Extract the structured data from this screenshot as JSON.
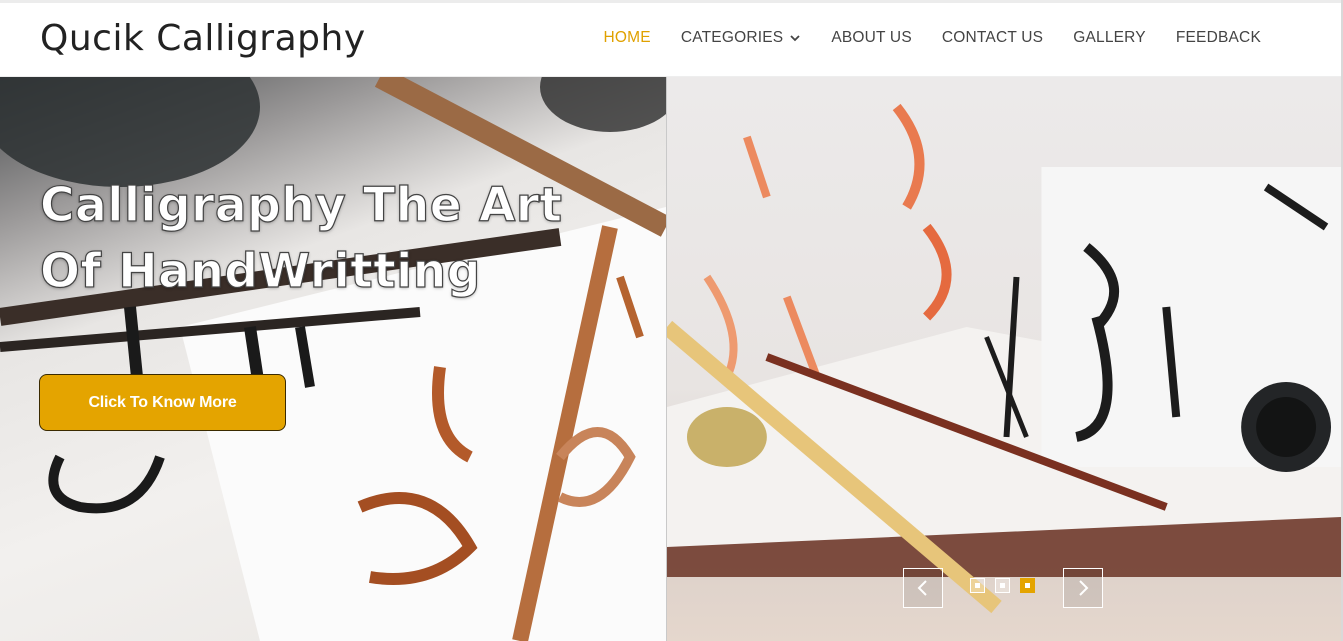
{
  "header": {
    "brand": "Qucik Calligraphy",
    "nav": [
      {
        "label": "HOME",
        "active": true
      },
      {
        "label": "CATEGORIES",
        "has_dropdown": true
      },
      {
        "label": "ABOUT US"
      },
      {
        "label": "CONTACT US"
      },
      {
        "label": "GALLERY"
      },
      {
        "label": "FEEDBACK"
      }
    ]
  },
  "hero": {
    "title": "Calligraphy The Art Of HandWritting",
    "cta_label": "Click To Know More",
    "slides": 3,
    "active_slide": 3
  },
  "colors": {
    "accent": "#e4a400",
    "nav_active": "#e0a100",
    "nav_text": "#444444"
  },
  "icons": {
    "dropdown": "chevron-down-icon",
    "prev": "chevron-left-icon",
    "next": "chevron-right-icon"
  }
}
